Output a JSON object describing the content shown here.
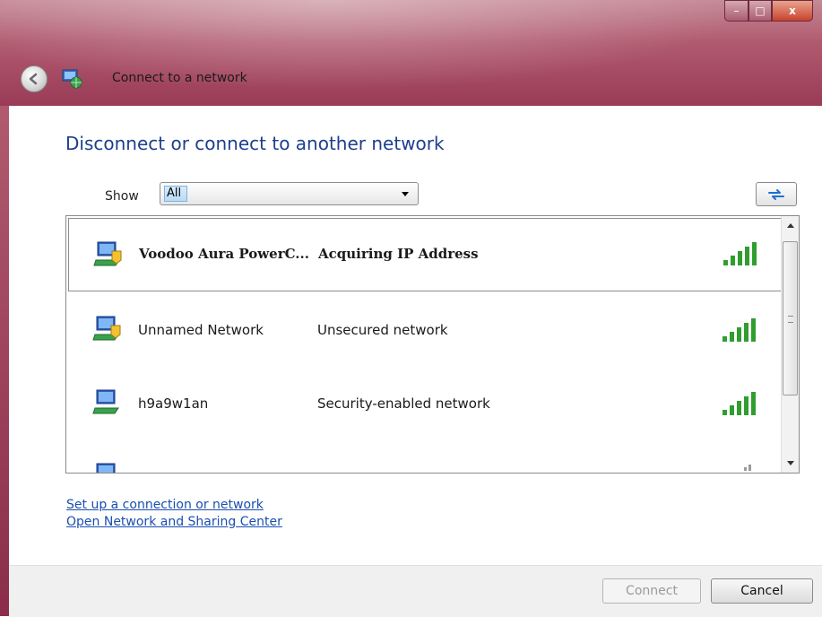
{
  "window": {
    "title": "Connect to a network",
    "caption": {
      "minimize": "–",
      "maximize": "□",
      "close": "x"
    }
  },
  "main": {
    "heading": "Disconnect or connect to another network",
    "show_label": "Show",
    "show_value": "All"
  },
  "networks": [
    {
      "name": "Voodoo Aura PowerC...",
      "status": "Acquiring IP Address",
      "signal": "full",
      "selected": true,
      "secured": true
    },
    {
      "name": "Unnamed Network",
      "status": "Unsecured network",
      "signal": "full",
      "selected": false,
      "secured": true
    },
    {
      "name": "h9a9w1an",
      "status": "Security-enabled network",
      "signal": "full",
      "selected": false,
      "secured": false
    },
    {
      "name": "",
      "status": "",
      "signal": "low",
      "selected": false,
      "secured": false
    }
  ],
  "links": {
    "setup": "Set up a connection or network",
    "sharing_center": "Open Network and Sharing Center"
  },
  "buttons": {
    "connect": "Connect",
    "cancel": "Cancel"
  },
  "colors": {
    "heading": "#1e3f8e",
    "link": "#1a4fb0",
    "signal": "#2f9e2f",
    "chrome": "#a2475c"
  }
}
